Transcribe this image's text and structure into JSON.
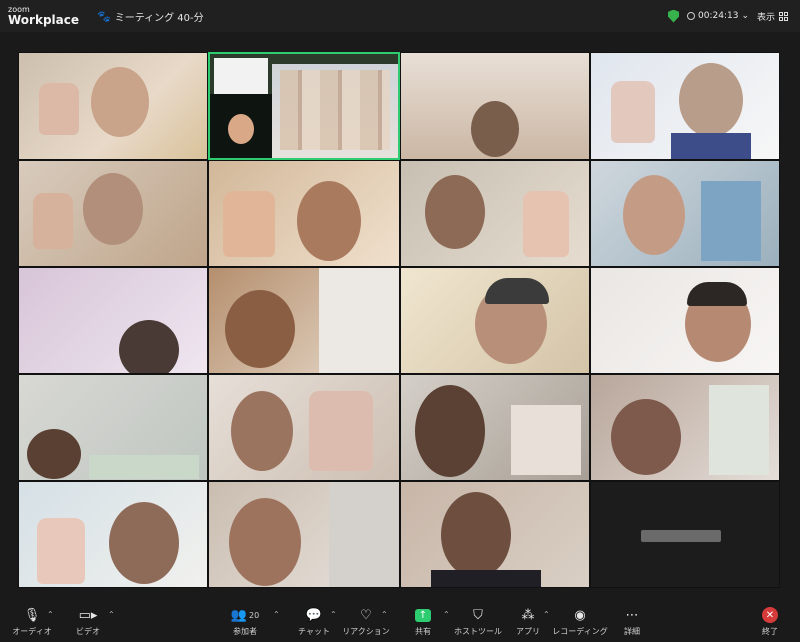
{
  "app": {
    "brand_top": "zoom",
    "brand_bottom": "Workplace"
  },
  "meeting": {
    "title": "ミーティング 40-分",
    "icon": "paw-icon"
  },
  "status": {
    "security_icon": "shield-icon",
    "elapsed": "00:24:13",
    "view_label": "表示"
  },
  "colors": {
    "active_speaker": "#2ecc71",
    "share": "#2ecc71",
    "end": "#d63b3b"
  },
  "toolbar": {
    "audio": "オーディオ",
    "video": "ビデオ",
    "participants": "参加者",
    "participant_count": "20",
    "chat": "チャット",
    "reactions": "リアクション",
    "share": "共有",
    "host_tools": "ホストツール",
    "apps": "アプリ",
    "recording": "レコーディング",
    "more": "詳細",
    "end": "終了"
  }
}
